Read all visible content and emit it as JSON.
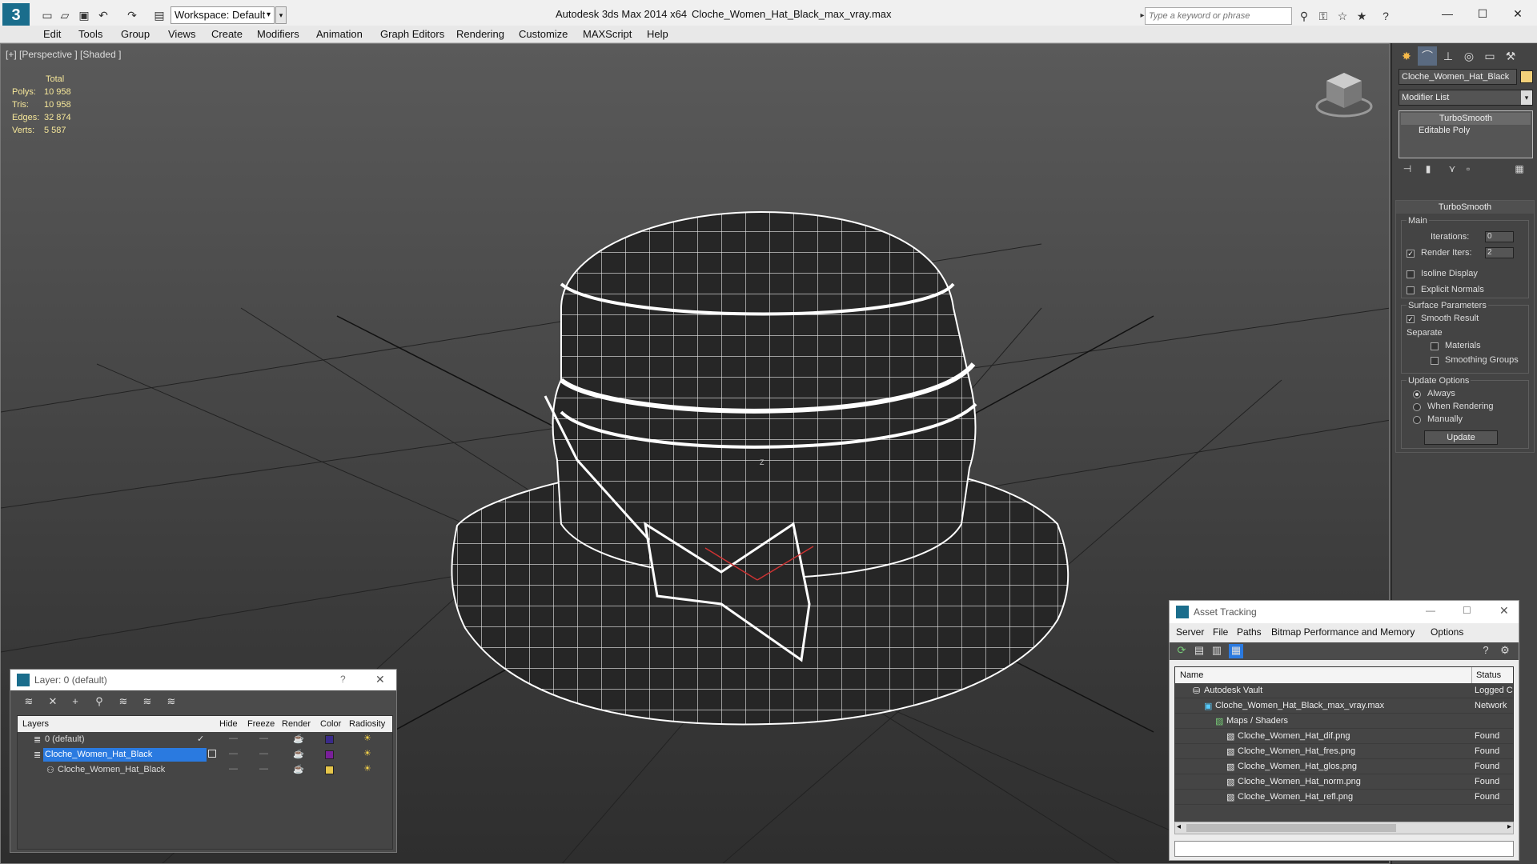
{
  "titlebar": {
    "app_title": "Autodesk 3ds Max  2014 x64",
    "file_title": "Cloche_Women_Hat_Black_max_vray.max",
    "workspace": "Workspace: Default",
    "search_placeholder": "Type a keyword or phrase",
    "app_logo": "3"
  },
  "menu": [
    "Edit",
    "Tools",
    "Group",
    "Views",
    "Create",
    "Modifiers",
    "Animation",
    "Graph Editors",
    "Rendering",
    "Customize",
    "MAXScript",
    "Help"
  ],
  "viewport": {
    "label": "[+] [Perspective ] [Shaded ]",
    "stats": {
      "header": "Total",
      "polys_label": "Polys:",
      "polys": "10 958",
      "tris_label": "Tris:",
      "tris": "10 958",
      "edges_label": "Edges:",
      "edges": "32 874",
      "verts_label": "Verts:",
      "verts": "5 587"
    },
    "axis_label": "Z"
  },
  "command_panel": {
    "object_name": "Cloche_Women_Hat_Black",
    "object_color": "#f2d07a",
    "modifier_list": "Modifier List",
    "stack": [
      "TurboSmooth",
      "Editable Poly"
    ],
    "rollout_title": "TurboSmooth",
    "main_label": "Main",
    "iterations_label": "Iterations:",
    "iterations_value": "0",
    "render_iters_label": "Render Iters:",
    "render_iters_value": "2",
    "isoline_label": "Isoline Display",
    "explicit_normals_label": "Explicit Normals",
    "surface_params_label": "Surface Parameters",
    "smooth_result_label": "Smooth Result",
    "separate_label": "Separate",
    "materials_label": "Materials",
    "smoothing_groups_label": "Smoothing Groups",
    "update_options_label": "Update Options",
    "always_label": "Always",
    "when_rendering_label": "When Rendering",
    "manually_label": "Manually",
    "update_button": "Update"
  },
  "layer_dialog": {
    "title": "Layer: 0 (default)",
    "help": "?",
    "close": "✕",
    "columns": [
      "Layers",
      "Hide",
      "Freeze",
      "Render",
      "Color",
      "Radiosity"
    ],
    "rows": [
      {
        "name": "0 (default)",
        "color": "#3a2a8a"
      },
      {
        "name": "Cloche_Women_Hat_Black",
        "color": "#7a1f9a"
      },
      {
        "name": "Cloche_Women_Hat_Black",
        "color": "#e6c64a"
      }
    ]
  },
  "asset_dialog": {
    "title": "Asset Tracking",
    "menu": [
      "Server",
      "File",
      "Paths",
      "Bitmap Performance and Memory",
      "Options"
    ],
    "col_name": "Name",
    "col_status": "Status",
    "rows": [
      {
        "name": "Autodesk Vault",
        "status": "Logged C"
      },
      {
        "name": "Cloche_Women_Hat_Black_max_vray.max",
        "status": "Network"
      },
      {
        "name": "Maps / Shaders",
        "status": ""
      },
      {
        "name": "Cloche_Women_Hat_dif.png",
        "status": "Found"
      },
      {
        "name": "Cloche_Women_Hat_fres.png",
        "status": "Found"
      },
      {
        "name": "Cloche_Women_Hat_glos.png",
        "status": "Found"
      },
      {
        "name": "Cloche_Women_Hat_norm.png",
        "status": "Found"
      },
      {
        "name": "Cloche_Women_Hat_refl.png",
        "status": "Found"
      }
    ]
  }
}
